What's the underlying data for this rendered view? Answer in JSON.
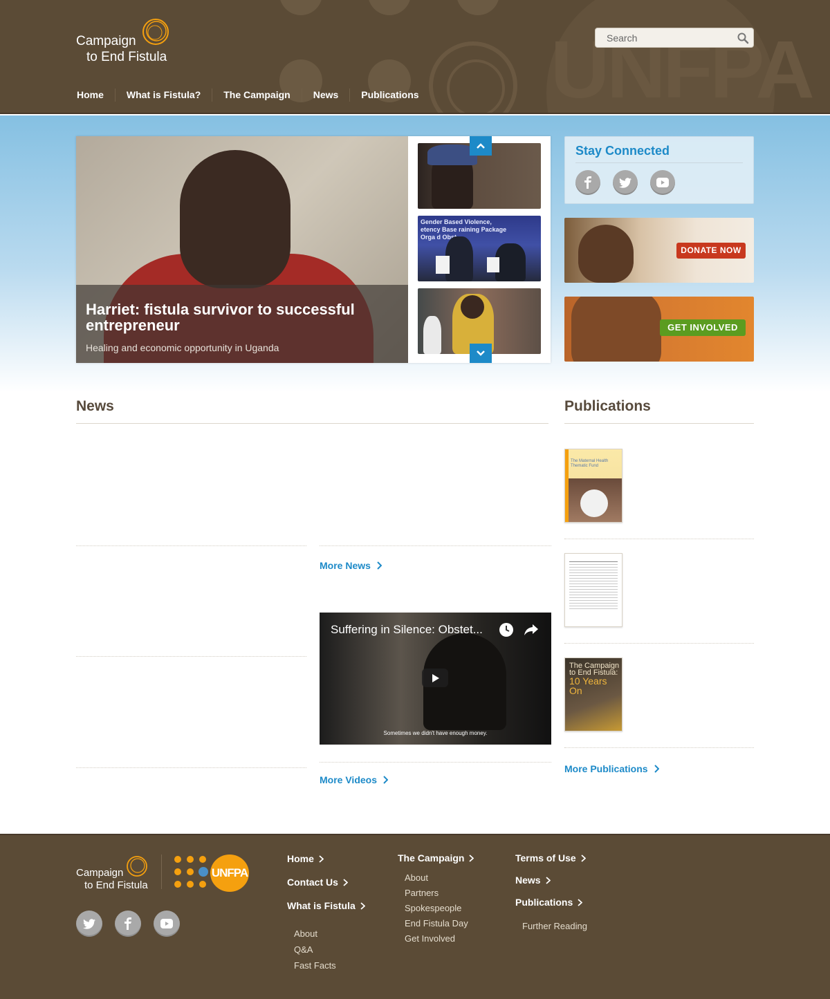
{
  "header": {
    "logo_line1": "Campaign",
    "logo_line2": "to End Fistula",
    "search_placeholder": "Search",
    "watermark": "UNFPA",
    "nav": [
      "Home",
      "What is Fistula?",
      "The Campaign",
      "News",
      "Publications"
    ]
  },
  "slider": {
    "title": "Harriet: fistula survivor to successful entrepreneur",
    "subtitle": "Healing and economic opportunity in Uganda",
    "thumb_text": [
      "Gender Based Violence,",
      "etency Base",
      "raining Package",
      "Orga",
      "d Obst"
    ]
  },
  "stay_connected": {
    "title": "Stay Connected",
    "icons": [
      "facebook-icon",
      "twitter-icon",
      "youtube-icon"
    ]
  },
  "promos": {
    "donate": "DONATE NOW",
    "involved": "GET INVOLVED"
  },
  "news": {
    "title": "News",
    "more_news": "More News",
    "more_videos": "More Videos",
    "video": {
      "title": "Suffering in Silence: Obstet...",
      "subtitle": "Sometimes we didn't have enough money."
    }
  },
  "publications": {
    "title": "Publications",
    "more": "More Publications",
    "cover1": "The Maternal Health Thematic Fund",
    "cover3_line1": "The Campaign to End Fistula:",
    "cover3_line2": "10 Years On"
  },
  "footer": {
    "logo_line1": "Campaign",
    "logo_line2": "to End Fistula",
    "partner": "UNFPA",
    "col1": {
      "home": "Home",
      "contact": "Contact Us",
      "what": "What is Fistula",
      "subs": [
        "About",
        "Q&A",
        "Fast Facts"
      ]
    },
    "col2": {
      "main": "The Campaign",
      "subs": [
        "About",
        "Partners",
        "Spokespeople",
        "End Fistula Day",
        "Get Involved"
      ]
    },
    "col3": {
      "terms": "Terms of Use",
      "news": "News",
      "pubs": "Publications",
      "subs": [
        "Further Reading"
      ]
    }
  },
  "colors": {
    "header_brown": "#5b4b36",
    "accent_blue": "#1d8ac8",
    "logo_orange": "#f5a00f",
    "donate_red": "#c8381e",
    "involved_green": "#5b9c20"
  }
}
